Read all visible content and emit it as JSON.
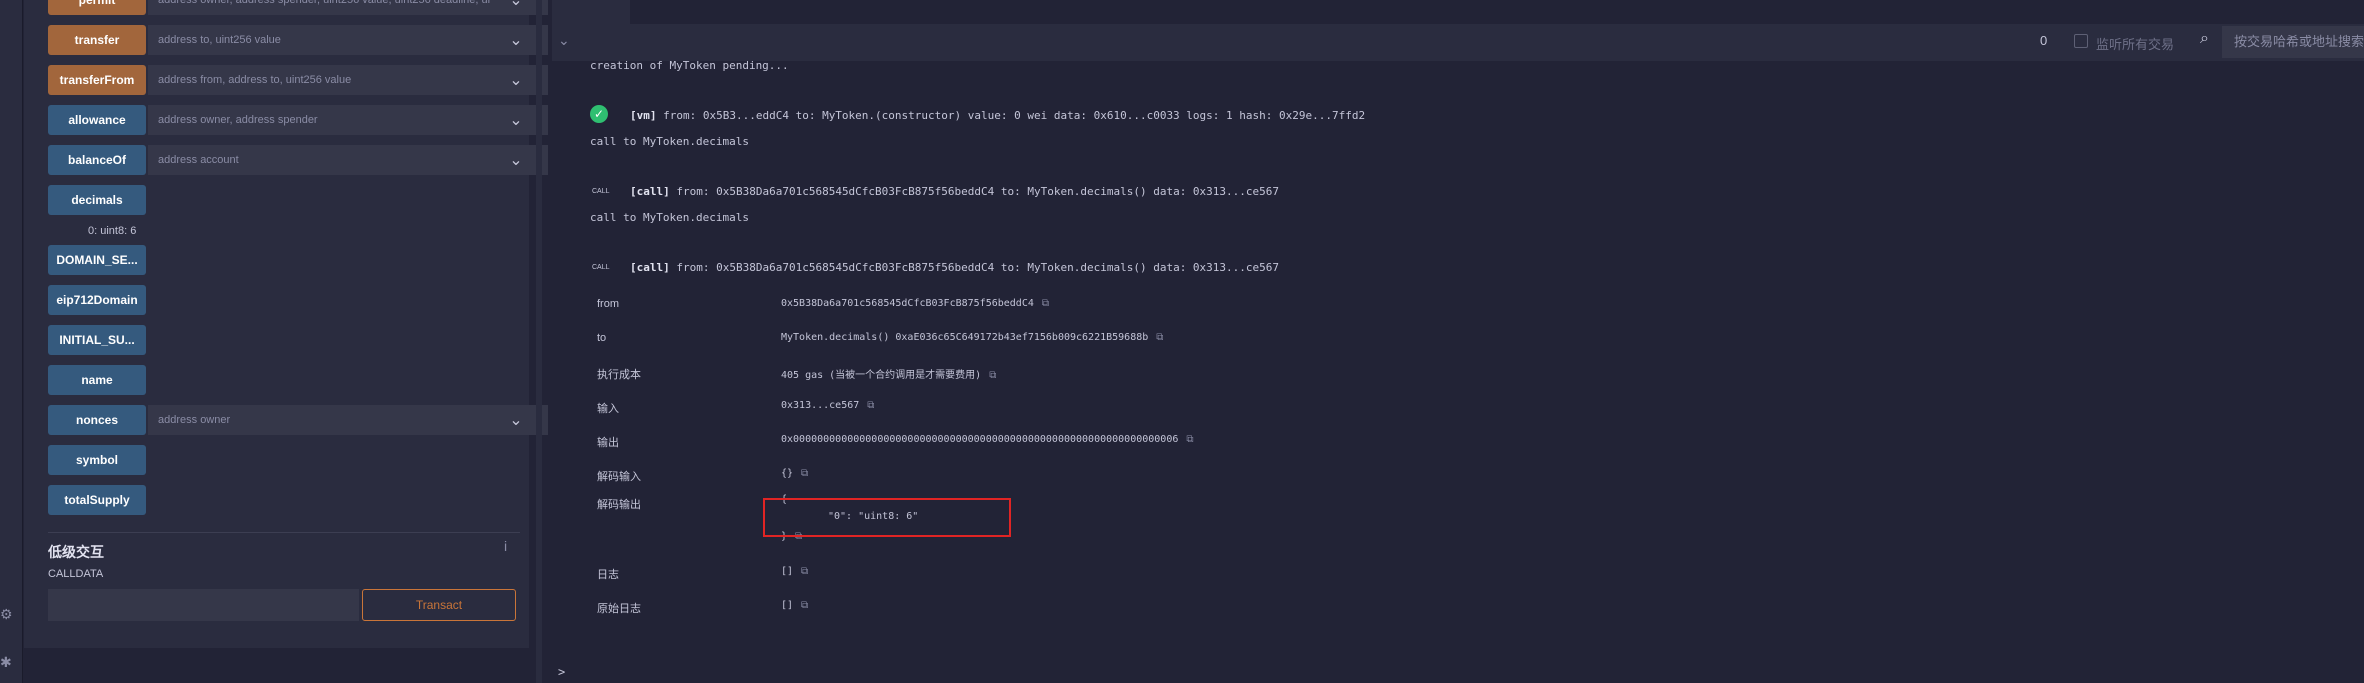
{
  "left_rail": {
    "icons": [
      "settings-icon",
      "plugin-icon"
    ]
  },
  "functions": [
    {
      "label": "permit",
      "color": "orange",
      "placeholder": "address owner, address spender, uint256 value, uint256 deadline, ui",
      "expandable": true
    },
    {
      "label": "transfer",
      "color": "orange",
      "placeholder": "address to, uint256 value",
      "expandable": true
    },
    {
      "label": "transferFrom",
      "color": "orange",
      "placeholder": "address from, address to, uint256 value",
      "expandable": true
    },
    {
      "label": "allowance",
      "color": "blue",
      "placeholder": "address owner, address spender",
      "expandable": true
    },
    {
      "label": "balanceOf",
      "color": "blue",
      "placeholder": "address account",
      "expandable": true
    },
    {
      "label": "decimals",
      "color": "blue"
    },
    {
      "label": "DOMAIN_SE...",
      "color": "blue"
    },
    {
      "label": "eip712Domain",
      "color": "blue"
    },
    {
      "label": "INITIAL_SU...",
      "color": "blue"
    },
    {
      "label": "name",
      "color": "blue"
    },
    {
      "label": "nonces",
      "color": "blue",
      "placeholder": "address owner",
      "expandable": true
    },
    {
      "label": "symbol",
      "color": "blue"
    },
    {
      "label": "totalSupply",
      "color": "blue"
    }
  ],
  "decimals_output": "0: uint8: 6",
  "low_level": {
    "title": "低级交互",
    "calldata_label": "CALLDATA",
    "transact_label": "Transact"
  },
  "terminal_header": {
    "count": "0",
    "listen_label": "监听所有交易",
    "search_placeholder": "按交易哈希或地址搜索"
  },
  "terminal": {
    "pending": "creation of MyToken pending...",
    "vm_tag": "[vm]",
    "vm_line": "from: 0x5B3...eddC4 to: MyToken.(constructor) value: 0 wei data: 0x610...c0033 logs: 1 hash: 0x29e...7ffd2",
    "call_to_1": "call to MyToken.decimals",
    "call_badge": "CALL",
    "call_tag": "[call]",
    "call_line_1": "from: 0x5B38Da6a701c568545dCfcB03FcB875f56beddC4 to: MyToken.decimals() data: 0x313...ce567",
    "call_to_2": "call to MyToken.decimals",
    "call_line_2": "from: 0x5B38Da6a701c568545dCfcB03FcB875f56beddC4 to: MyToken.decimals() data: 0x313...ce567",
    "details": [
      {
        "label": "from",
        "value": "0x5B38Da6a701c568545dCfcB03FcB875f56beddC4"
      },
      {
        "label": "to",
        "value": "MyToken.decimals() 0xaE036c65C649172b43ef7156b009c6221B59688b"
      },
      {
        "label": "执行成本",
        "value": "405 gas (当被一个合约调用是才需要费用)"
      },
      {
        "label": "输入",
        "value": "0x313...ce567"
      },
      {
        "label": "输出",
        "value": "0x0000000000000000000000000000000000000000000000000000000000000006"
      },
      {
        "label": "解码输入",
        "value": "{}"
      },
      {
        "label": "解码输出",
        "value_open": "{",
        "value_line": "\"0\": \"uint8: 6\"",
        "value_close": "}"
      },
      {
        "label": "日志",
        "value": "[]"
      },
      {
        "label": "原始日志",
        "value": "[]"
      }
    ],
    "prompt": ">"
  },
  "colors": {
    "orange": "#a2663c",
    "blue": "#355a7e",
    "accent": "#c97539",
    "highlight": "#e02424",
    "success": "#2fbf71"
  }
}
